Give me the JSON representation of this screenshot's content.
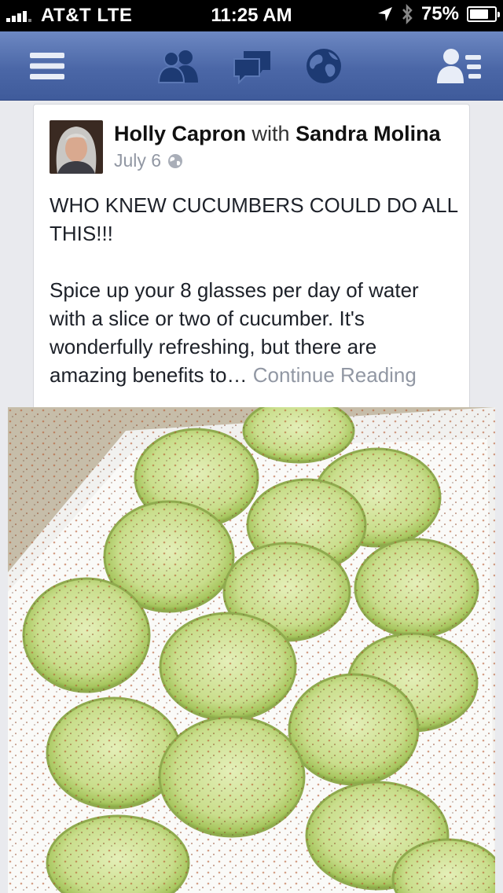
{
  "status_bar": {
    "carrier": "AT&T  LTE",
    "time": "11:25 AM",
    "battery_percent": "75%",
    "battery_level": 0.75
  },
  "navbar": {
    "icons": [
      "menu-icon",
      "friends-icon",
      "messages-icon",
      "globe-icon",
      "contacts-icon"
    ]
  },
  "post": {
    "author": "Holly Capron",
    "with_text": "with",
    "tagged": "Sandra Molina",
    "date": "July 6",
    "privacy_icon": "globe-icon",
    "headline": "WHO KNEW CUCUMBERS COULD DO ALL THIS!!!",
    "body": "Spice up your 8 glasses per day of water with a slice or two of cucumber. It's wonderfully refreshing, but there are amazing benefits to…",
    "continue_label": "Continue Reading"
  },
  "colors": {
    "nav_blue": "#4b67a7",
    "muted_text": "#9197a3"
  }
}
